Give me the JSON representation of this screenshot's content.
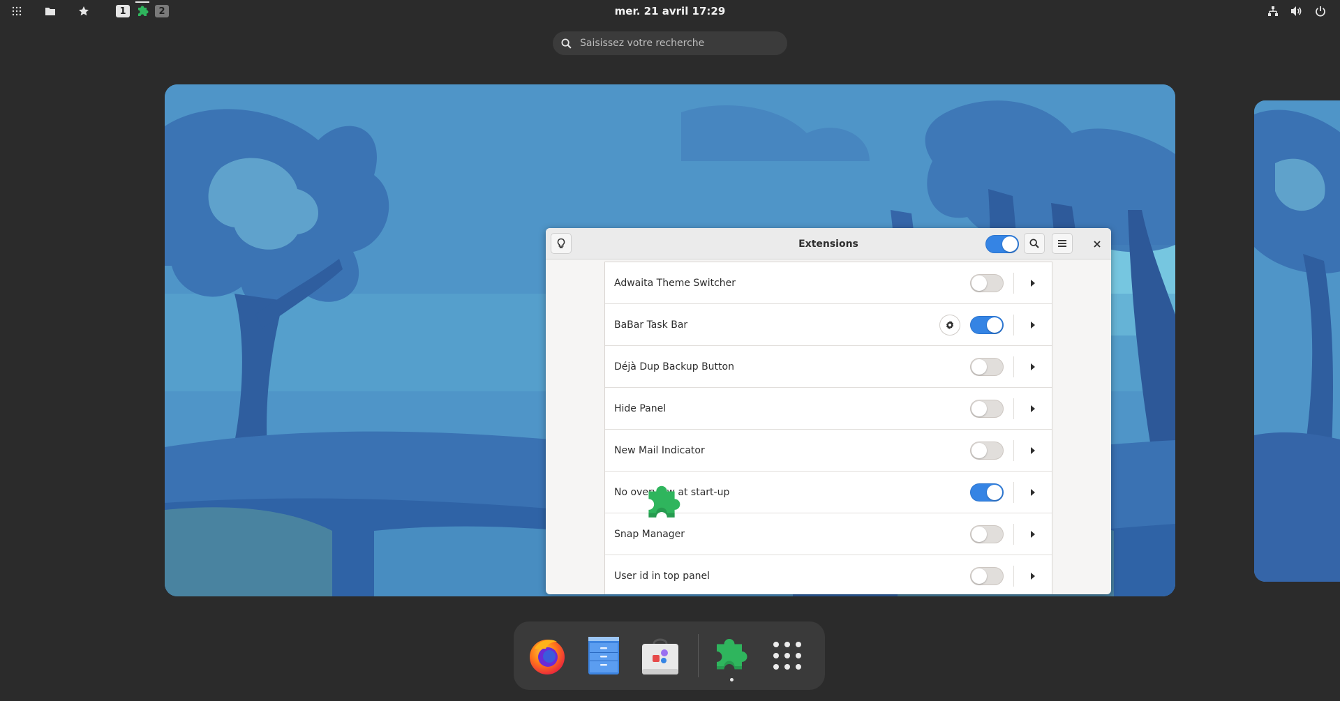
{
  "topbar": {
    "workspace_1": "1",
    "workspace_2": "2",
    "clock": "mer. 21 avril  17:29"
  },
  "search": {
    "placeholder": "Saisissez votre recherche"
  },
  "window": {
    "title": "Extensions",
    "global_toggle_on": true,
    "extensions": [
      {
        "name": "Adwaita Theme Switcher",
        "enabled": false,
        "has_settings": false
      },
      {
        "name": "BaBar Task Bar",
        "enabled": true,
        "has_settings": true
      },
      {
        "name": "Déjà Dup Backup Button",
        "enabled": false,
        "has_settings": false
      },
      {
        "name": "Hide Panel",
        "enabled": false,
        "has_settings": false
      },
      {
        "name": "New Mail Indicator",
        "enabled": false,
        "has_settings": false
      },
      {
        "name": "No overview at start-up",
        "enabled": true,
        "has_settings": false
      },
      {
        "name": "Snap Manager",
        "enabled": false,
        "has_settings": false
      },
      {
        "name": "User id in top panel",
        "enabled": false,
        "has_settings": false
      }
    ]
  },
  "dash": {
    "apps": [
      "firefox-icon",
      "files-icon",
      "software-icon",
      "extensions-icon",
      "app-grid-icon"
    ]
  },
  "colors": {
    "accent": "#3584e4",
    "extensions_green": "#2fb55d",
    "topbar_bg": "#2b2b2b"
  }
}
